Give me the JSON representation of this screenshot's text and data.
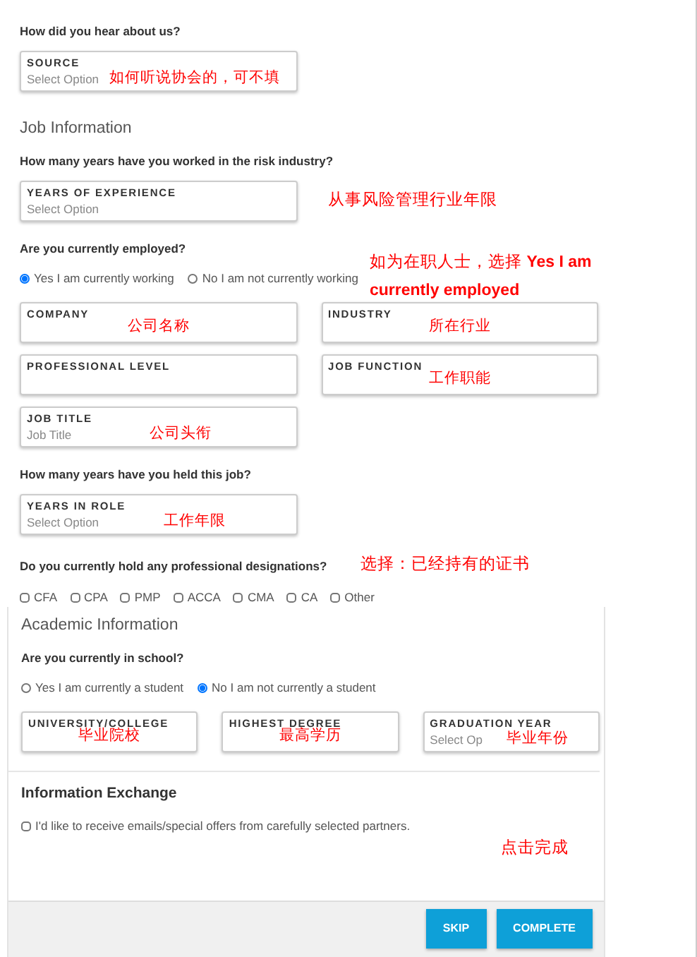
{
  "upper": [
    {
      "kind": "question",
      "text": "How did you hear about us?"
    },
    {
      "kind": "fields",
      "fields": [
        {
          "kind": "field",
          "label": "SOURCE",
          "placeholder": "Select Option",
          "annotation": "如何听说协会的，可不填"
        }
      ]
    },
    {
      "kind": "heading",
      "text": "Job Information"
    },
    {
      "kind": "question",
      "text": "How many years have you worked in the risk industry?"
    },
    {
      "kind": "fields",
      "fields": [
        {
          "kind": "field",
          "label": "YEARS OF EXPERIENCE",
          "placeholder": "Select Option"
        },
        {
          "kind": "note",
          "text": "从事风险管理行业年限"
        }
      ]
    },
    {
      "kind": "question",
      "text": "Are you currently employed?"
    },
    {
      "kind": "radios",
      "options": [
        {
          "label": "Yes I am currently working",
          "selected": true
        },
        {
          "label": "No I am not currently working",
          "selected": false
        }
      ],
      "annotation": "如为在职人士，选择 **Yes I am currently employed**"
    },
    {
      "kind": "fields",
      "fields": [
        {
          "kind": "field",
          "label": "COMPANY",
          "annotation": "公司名称"
        },
        {
          "kind": "field",
          "label": "INDUSTRY",
          "annotation": "所在行业"
        }
      ]
    },
    {
      "kind": "fields",
      "fields": [
        {
          "kind": "field",
          "label": "PROFESSIONAL LEVEL"
        },
        {
          "kind": "field",
          "label": "JOB FUNCTION",
          "annotation": "工作职能"
        }
      ]
    },
    {
      "kind": "fields",
      "fields": [
        {
          "kind": "field",
          "label": "JOB TITLE",
          "placeholder": "Job Title",
          "annotation": "公司头衔"
        }
      ]
    },
    {
      "kind": "question",
      "text": "How many years have you held this job?"
    },
    {
      "kind": "fields",
      "fields": [
        {
          "kind": "field",
          "label": "YEARS IN ROLE",
          "placeholder": "Select Option",
          "annotation": "工作年限"
        }
      ]
    },
    {
      "kind": "question",
      "text": "Do you currently hold any professional designations?",
      "annotation": "选择：已经持有的证书"
    },
    {
      "kind": "checks",
      "options": [
        {
          "label": "CFA",
          "checked": false
        },
        {
          "label": "CPA",
          "checked": false
        },
        {
          "label": "PMP",
          "checked": false
        },
        {
          "label": "ACCA",
          "checked": false
        },
        {
          "label": "CMA",
          "checked": false
        },
        {
          "label": "CA",
          "checked": false
        },
        {
          "label": "Other",
          "checked": false
        }
      ]
    }
  ],
  "academic": [
    {
      "kind": "heading",
      "text": "Academic Information"
    },
    {
      "kind": "question",
      "text": "Are you currently in school?"
    },
    {
      "kind": "radios",
      "options": [
        {
          "label": "Yes I am currently a student",
          "selected": false
        },
        {
          "label": "No I am not currently a student",
          "selected": true
        }
      ]
    },
    {
      "kind": "fields",
      "fields": [
        {
          "kind": "field",
          "label": "UNIVERSITY/COLLEGE",
          "annotation": "毕业院校"
        },
        {
          "kind": "field",
          "label": "HIGHEST DEGREE",
          "annotation": "最高学历"
        },
        {
          "kind": "field",
          "label": "GRADUATION YEAR",
          "placeholder": "Select Op",
          "annotation": "毕业年份"
        }
      ]
    }
  ],
  "information_exchange": {
    "title": "Information Exchange",
    "consent": {
      "label": "I'd like to receive emails/special offers from carefully selected partners.",
      "checked": false
    }
  },
  "footer": {
    "annotation": "点击完成",
    "buttons": [
      {
        "label": "SKIP"
      },
      {
        "label": "COMPLETE"
      }
    ]
  }
}
